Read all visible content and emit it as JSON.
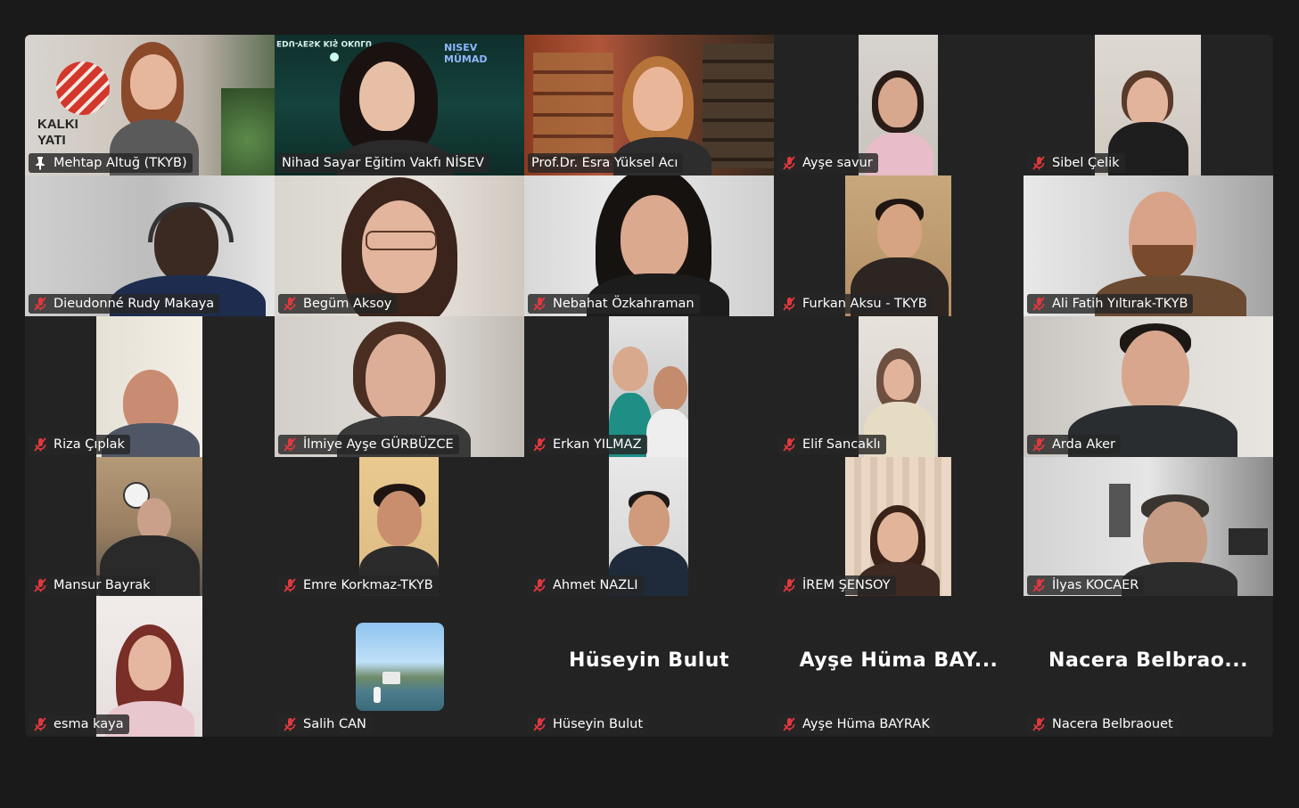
{
  "colors": {
    "background": "#1a1a1a",
    "tile": "#232323",
    "active_speaker_border": "#2fd17a",
    "muted_icon": "#e0383e",
    "label_text": "#ffffff"
  },
  "participants": [
    {
      "name": "Mehtap Altuğ (TKYB)",
      "status_icon": "pin-icon",
      "logo_text": "KALKI\nYATI"
    },
    {
      "name": "Nihad Sayar Eğitim Vakfı NİSEV",
      "status_icon": "none",
      "active": true,
      "banner_text": "EDU-YESK KIŞ OKULU"
    },
    {
      "name": "Prof.Dr. Esra Yüksel Acı",
      "status_icon": "none"
    },
    {
      "name": "Ayşe savur",
      "status_icon": "mic-muted-icon"
    },
    {
      "name": "Sibel Çelik",
      "status_icon": "mic-muted-icon"
    },
    {
      "name": "Dieudonné Rudy Makaya",
      "status_icon": "mic-muted-icon"
    },
    {
      "name": "Begüm Aksoy",
      "status_icon": "mic-muted-icon"
    },
    {
      "name": "Nebahat Özkahraman",
      "status_icon": "mic-muted-icon"
    },
    {
      "name": "Furkan Aksu - TKYB",
      "status_icon": "mic-muted-icon"
    },
    {
      "name": "Ali Fatih Yıltırak-TKYB",
      "status_icon": "mic-muted-icon"
    },
    {
      "name": "Riza Çıplak",
      "status_icon": "mic-muted-icon"
    },
    {
      "name": "İlmiye Ayşe GÜRBÜZCE",
      "status_icon": "mic-muted-icon"
    },
    {
      "name": "Erkan YILMAZ",
      "status_icon": "mic-muted-icon"
    },
    {
      "name": "Elif Sancaklı",
      "status_icon": "mic-muted-icon"
    },
    {
      "name": "Arda Aker",
      "status_icon": "mic-muted-icon"
    },
    {
      "name": "Mansur Bayrak",
      "status_icon": "mic-muted-icon"
    },
    {
      "name": "Emre Korkmaz-TKYB",
      "status_icon": "mic-muted-icon"
    },
    {
      "name": "Ahmet NAZLI",
      "status_icon": "mic-muted-icon"
    },
    {
      "name": "İREM ŞENSOY",
      "status_icon": "mic-muted-icon"
    },
    {
      "name": "İlyas KOCAER",
      "status_icon": "mic-muted-icon"
    },
    {
      "name": "esma kaya",
      "status_icon": "mic-muted-icon"
    },
    {
      "name": "Salih CAN",
      "status_icon": "mic-muted-icon"
    },
    {
      "name": "Hüseyin Bulut",
      "status_icon": "mic-muted-icon",
      "display_name": "Hüseyin Bulut"
    },
    {
      "name": "Ayşe Hüma BAYRAK",
      "status_icon": "mic-muted-icon",
      "display_name": "Ayşe Hüma BAY..."
    },
    {
      "name": "Nacera Belbraouet",
      "status_icon": "mic-muted-icon",
      "display_name": "Nacera Belbrao..."
    }
  ]
}
